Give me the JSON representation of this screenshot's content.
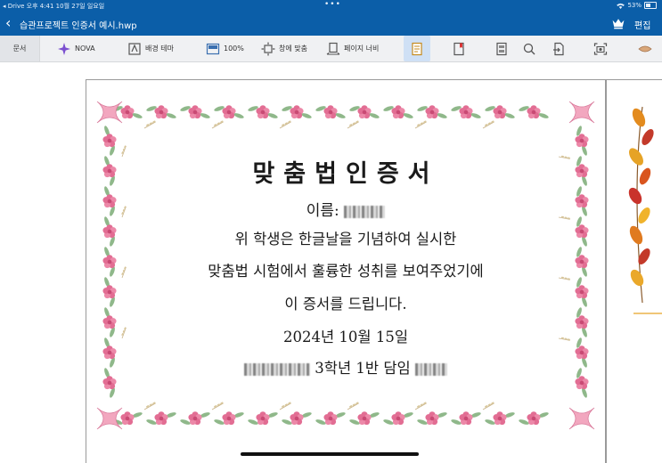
{
  "status_bar": {
    "left": "◂ Drive  오후 4:41  10월 27일 일요일",
    "battery": "53%"
  },
  "title_bar": {
    "file_name": "습관프로젝트 인증서 예시.hwp",
    "edit_label": "편집"
  },
  "toolbar": {
    "doc_label": "문서",
    "nova_label": "NOVA",
    "background_theme_label": "배경 테마",
    "zoom_label": "100%",
    "fit_window_label": "창에 맞춤",
    "page_width_label": "페이지 너비"
  },
  "certificate": {
    "heading": "맞춤법인증서",
    "name_label": "이름:",
    "line1": "위 학생은 한글날을 기념하여 실시한",
    "line2": "맞춤법 시험에서 훌륭한 성취를 보여주었기에",
    "line3": "이 증서를 드립니다.",
    "date": "2024년 10월 15일",
    "class_label": "3학년 1반 담임"
  },
  "colors": {
    "accent": "#0b5ea8",
    "flower_pink": "#e26d93",
    "leaf_green": "#8fb88a"
  }
}
